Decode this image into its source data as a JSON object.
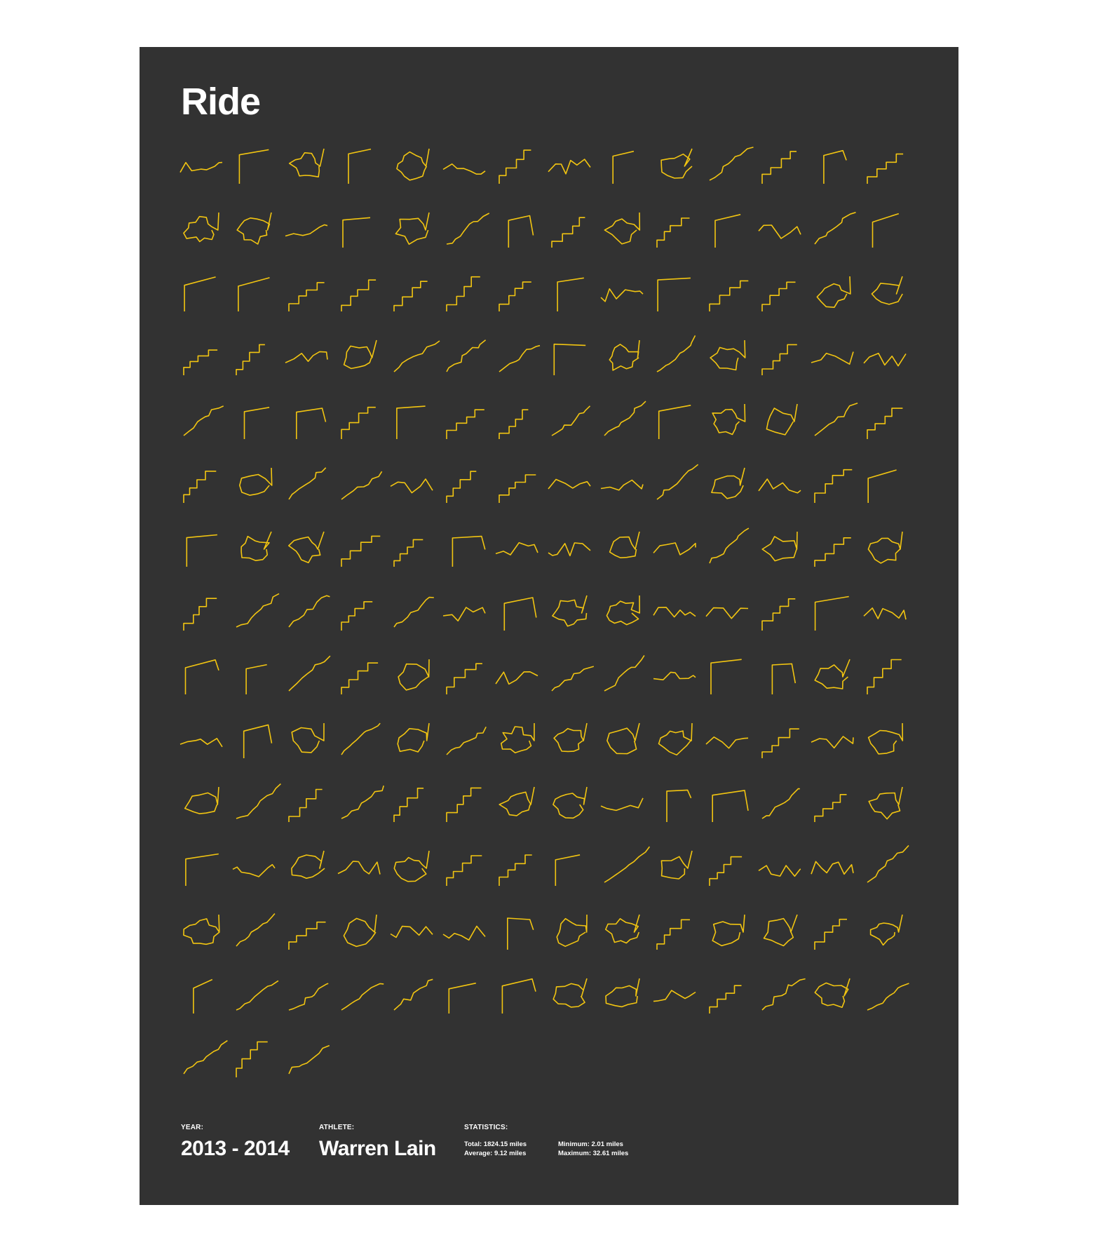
{
  "poster": {
    "title": "Ride",
    "background": "#323232",
    "route_color": "#f2c511",
    "route_count": 199,
    "routes_per_row": 14,
    "footer": {
      "year_label": "YEAR:",
      "year_value": "2013 - 2014",
      "athlete_label": "ATHLETE:",
      "athlete_value": "Warren Lain",
      "stats_label": "STATISTICS:",
      "stats": {
        "total": "Total: 1824.15 miles",
        "average": "Average: 9.12 miles",
        "minimum": "Minimum: 2.01 miles",
        "maximum": "Maximum: 32.61 miles"
      }
    }
  }
}
